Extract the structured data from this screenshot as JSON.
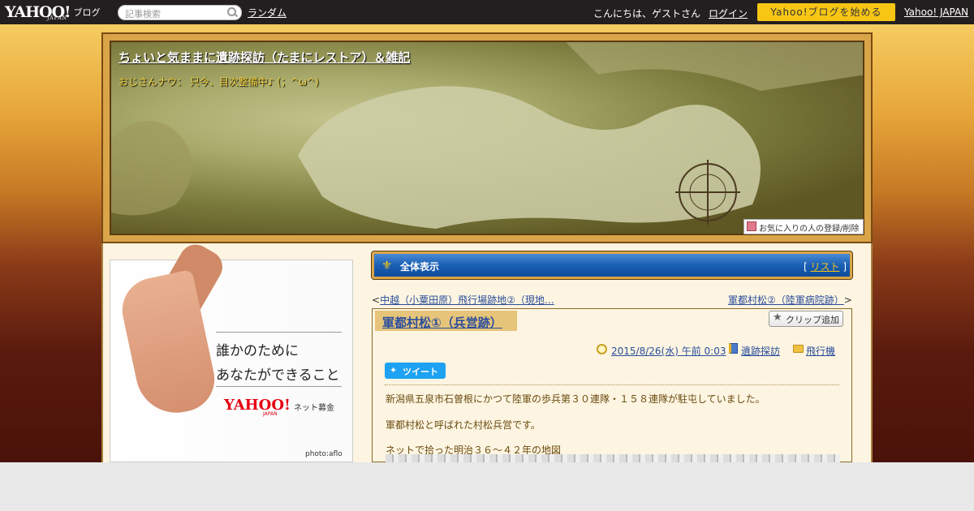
{
  "topbar": {
    "logo_text": "YAHOO!",
    "logo_sub": "JAPAN",
    "logo_blog": "ブログ",
    "search_placeholder": "記事検索",
    "random_link": "ランダム",
    "greeting": "こんにちは、ゲストさん",
    "login_link": "ログイン",
    "start_button": "Yahoo!ブログを始める",
    "yahoo_japan_link": "Yahoo! JAPAN"
  },
  "header": {
    "title": "ちょいと気ままに遺跡探訪（たまにレストア）＆雑記",
    "subtitle": "おじさんナウ： 只今、目次整備中♪ (；^ω^)",
    "favorite_button": "お気に入りの人の登録/削除"
  },
  "ad": {
    "line1": "誰かのために",
    "line2": "あなたができること",
    "logo": "YAHOO!",
    "logo_sub": "JAPAN",
    "tag": "ネット募金",
    "credit": "photo:aflo"
  },
  "main": {
    "fullview_label": "全体表示",
    "list_open": "[ ",
    "list_link": "リスト",
    "list_close": " ]",
    "nav_prev_prefix": "<",
    "nav_prev": "中越（小粟田原）飛行場跡地②（現地…",
    "nav_next": "軍都村松②（陸軍病院跡）",
    "nav_next_suffix": ">"
  },
  "article": {
    "title": "軍都村松①（兵営跡）",
    "clip_button": "クリップ追加",
    "date": "2015/8/26(水) 午前 0:03",
    "category": "遺跡探訪",
    "folder": "飛行機",
    "tweet_button": "ツイート",
    "paragraphs": [
      "新潟県五泉市石曽根にかつて陸軍の歩兵第３０連隊・１５８連隊が駐屯していました。",
      "軍都村松と呼ばれた村松兵営です。",
      "ネットで拾った明治３６～４２年の地図"
    ]
  }
}
